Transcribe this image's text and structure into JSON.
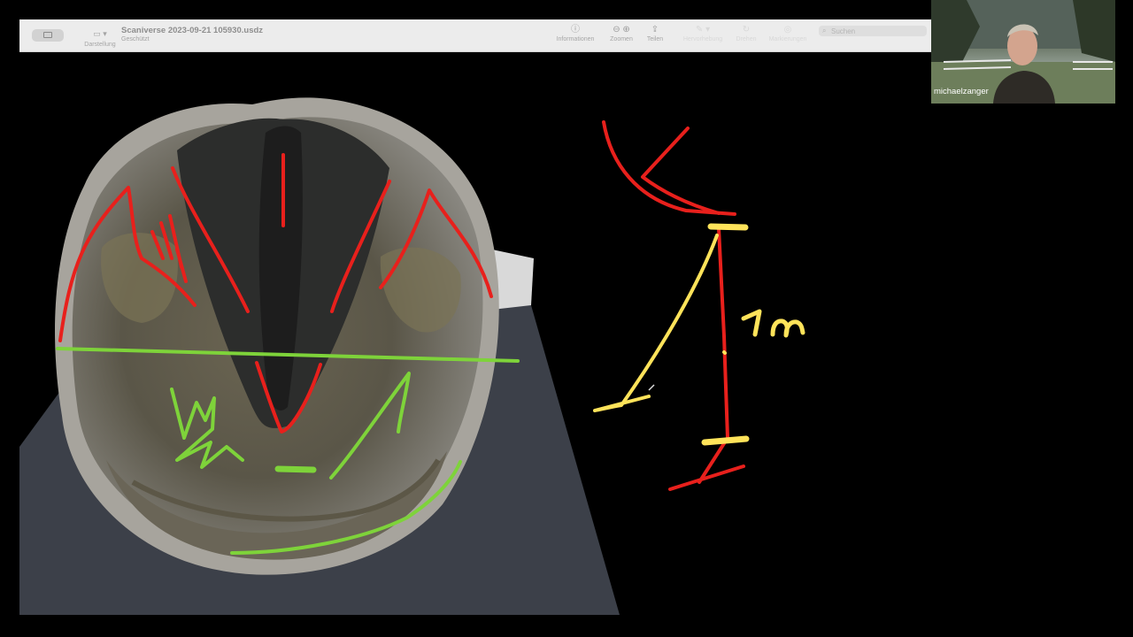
{
  "window": {
    "title": "Scaniverse 2023-09-21 105930.usdz",
    "subtitle": "Geschützt"
  },
  "toolbar": {
    "view_label": "Darstellung",
    "info_label": "Informationen",
    "zoom_label": "Zoomen",
    "share_label": "Teilen",
    "dim_label_1": "Hervorhebung",
    "dim_label_2": "Drehen",
    "dim_label_3": "Markierungen",
    "search_placeholder": "Suchen"
  },
  "annotations": {
    "measurement_label": "1m",
    "colors": {
      "red": "#e8201c",
      "green": "#7ed33a",
      "yellow": "#ffe35a"
    }
  },
  "webcam": {
    "participant_name": "michaelzanger"
  }
}
